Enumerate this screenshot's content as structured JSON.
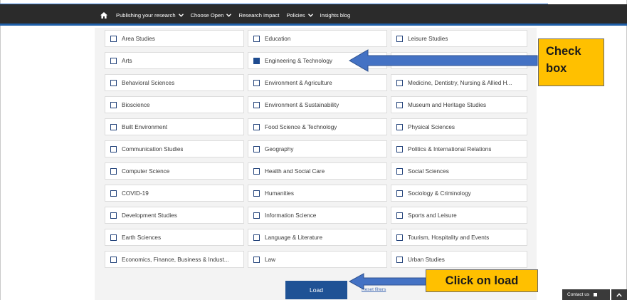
{
  "nav": {
    "home_icon": "home-icon",
    "items": [
      {
        "label": "Publishing your research",
        "has_dropdown": true
      },
      {
        "label": "Choose Open",
        "has_dropdown": true
      },
      {
        "label": "Research impact",
        "has_dropdown": false
      },
      {
        "label": "Policies",
        "has_dropdown": true
      },
      {
        "label": "Insights blog",
        "has_dropdown": false
      }
    ]
  },
  "subjects": {
    "col1": [
      {
        "label": "Area Studies",
        "checked": false
      },
      {
        "label": "Arts",
        "checked": false
      },
      {
        "label": "Behavioral Sciences",
        "checked": false
      },
      {
        "label": "Bioscience",
        "checked": false
      },
      {
        "label": "Built Environment",
        "checked": false
      },
      {
        "label": "Communication Studies",
        "checked": false
      },
      {
        "label": "Computer Science",
        "checked": false
      },
      {
        "label": "COVID-19",
        "checked": false
      },
      {
        "label": "Development Studies",
        "checked": false
      },
      {
        "label": "Earth Sciences",
        "checked": false
      },
      {
        "label": "Economics, Finance, Business & Indust...",
        "checked": false
      }
    ],
    "col2": [
      {
        "label": "Education",
        "checked": false
      },
      {
        "label": "Engineering & Technology",
        "checked": true
      },
      {
        "label": "Environment & Agriculture",
        "checked": false
      },
      {
        "label": "Environment & Sustainability",
        "checked": false
      },
      {
        "label": "Food Science & Technology",
        "checked": false
      },
      {
        "label": "Geography",
        "checked": false
      },
      {
        "label": "Health and Social Care",
        "checked": false
      },
      {
        "label": "Humanities",
        "checked": false
      },
      {
        "label": "Information Science",
        "checked": false
      },
      {
        "label": "Language & Literature",
        "checked": false
      },
      {
        "label": "Law",
        "checked": false
      }
    ],
    "col3": [
      {
        "label": "Leisure Studies",
        "checked": false
      },
      {
        "label": "",
        "checked": false
      },
      {
        "label": "Medicine, Dentistry, Nursing & Allied H...",
        "checked": false
      },
      {
        "label": "Museum and Heritage Studies",
        "checked": false
      },
      {
        "label": "Physical Sciences",
        "checked": false
      },
      {
        "label": "Politics & International Relations",
        "checked": false
      },
      {
        "label": "Social Sciences",
        "checked": false
      },
      {
        "label": "Sociology & Criminology",
        "checked": false
      },
      {
        "label": "Sports and Leisure",
        "checked": false
      },
      {
        "label": "Tourism, Hospitality and Events",
        "checked": false
      },
      {
        "label": "Urban Studies",
        "checked": false
      }
    ]
  },
  "actions": {
    "load_label": "Load",
    "reset_label": "Reset filters"
  },
  "annotations": {
    "check_box": "Check box",
    "click_on_load": "Click on load"
  },
  "footer": {
    "contact_label": "Contact us"
  },
  "colors": {
    "accent": "#1f5295",
    "callout": "#ffc000",
    "arrow": "#4472c4",
    "navbar": "#2b2b2b"
  }
}
